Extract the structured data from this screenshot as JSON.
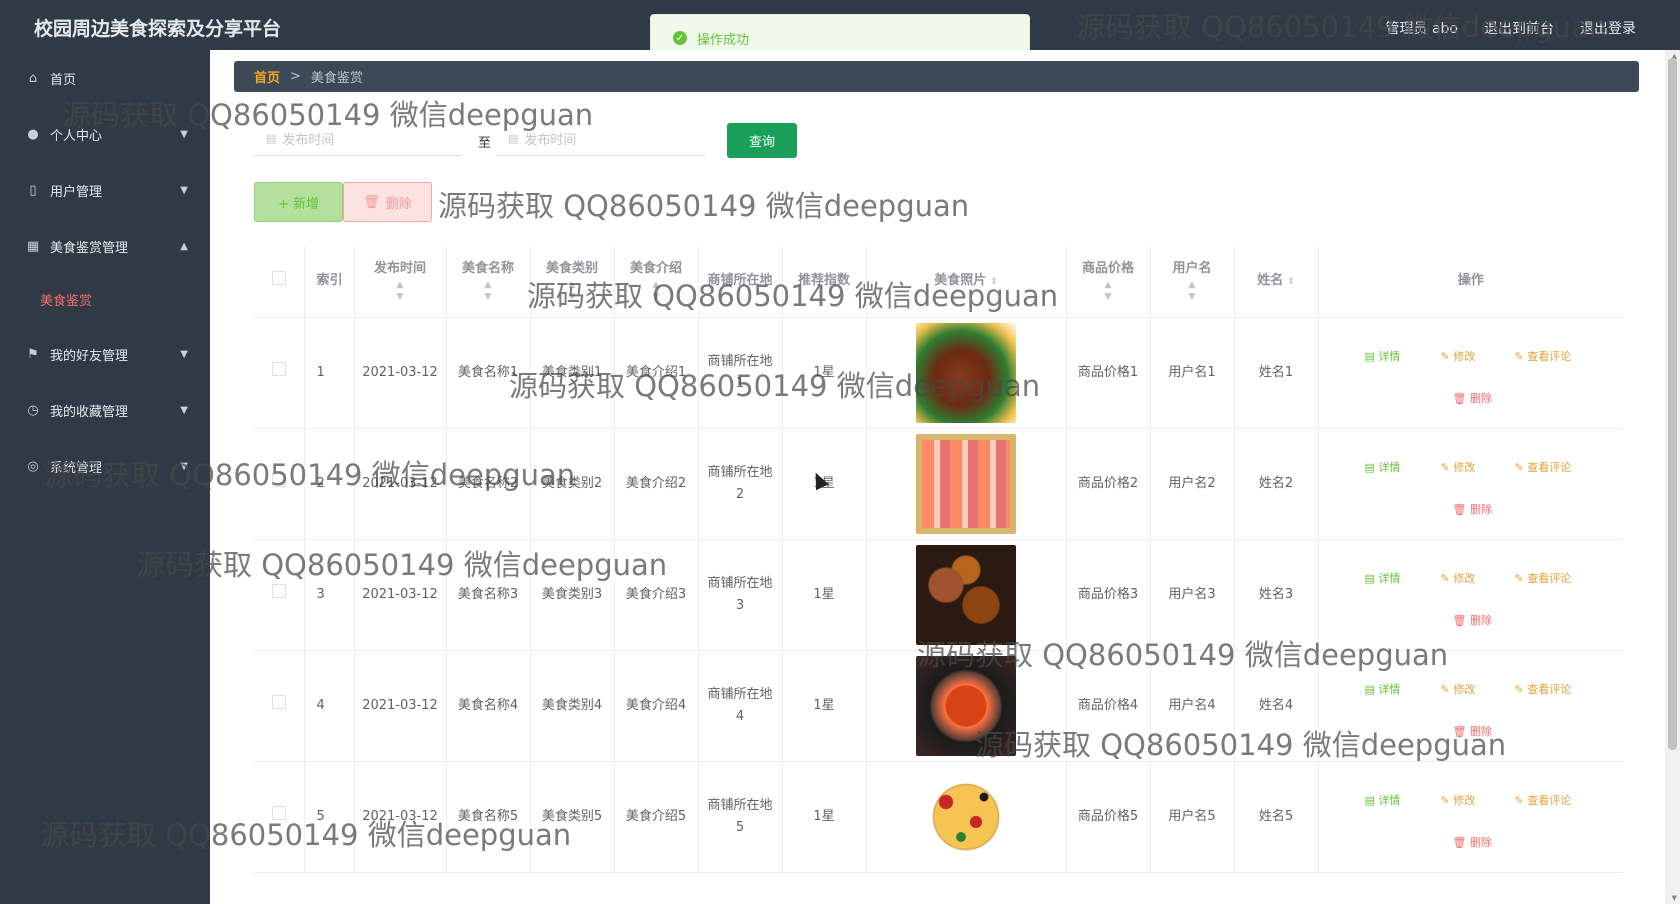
{
  "header": {
    "title": "校园周边美食探索及分享平台",
    "admin_label": "管理员 abo",
    "exit_backend": "退出到前台",
    "logout": "退出登录"
  },
  "toast": {
    "message": "操作成功"
  },
  "sidebar": {
    "items": [
      {
        "label": "首页",
        "icon": "home-icon"
      },
      {
        "label": "个人中心",
        "icon": "user-icon"
      },
      {
        "label": "用户管理",
        "icon": "mobile-icon"
      },
      {
        "label": "美食鉴赏管理",
        "icon": "grid-icon"
      },
      {
        "label": "美食鉴赏",
        "icon": ""
      },
      {
        "label": "我的好友管理",
        "icon": "flag-icon"
      },
      {
        "label": "我的收藏管理",
        "icon": "clock-icon"
      },
      {
        "label": "系统管理",
        "icon": "compass-icon"
      }
    ]
  },
  "breadcrumb": {
    "home": "首页",
    "separator": ">",
    "current": "美食鉴赏"
  },
  "filters": {
    "date_start_placeholder": "发布时间",
    "date_separator": "至",
    "date_end_placeholder": "发布时间",
    "query_label": "查询"
  },
  "actions": {
    "add_label": "+ 新增",
    "delete_label": "删除"
  },
  "table": {
    "headers": {
      "index": "索引",
      "publish_time": "发布时间",
      "food_name": "美食名称",
      "food_category": "美食类别",
      "food_intro": "美食介绍",
      "shop_location": "商铺所在地",
      "recommend": "推荐指数",
      "food_photo": "美食照片",
      "price": "商品价格",
      "username": "用户名",
      "name": "姓名",
      "operations": "操作"
    },
    "ops": {
      "detail": "详情",
      "edit": "修改",
      "review": "查看评论",
      "delete": "删除"
    },
    "rows": [
      {
        "index": "1",
        "time": "2021-03-12",
        "name": "美食名称1",
        "category": "美食类别1",
        "intro": "美食介绍1",
        "location": "商铺所在地1",
        "recommend": "1星",
        "photo": "food-1",
        "price": "商品价格1",
        "username": "用户名1",
        "fullname": "姓名1"
      },
      {
        "index": "2",
        "time": "2021-03-12",
        "name": "美食名称2",
        "category": "美食类别2",
        "intro": "美食介绍2",
        "location": "商铺所在地2",
        "recommend": "1星",
        "photo": "food-2",
        "price": "商品价格2",
        "username": "用户名2",
        "fullname": "姓名2"
      },
      {
        "index": "3",
        "time": "2021-03-12",
        "name": "美食名称3",
        "category": "美食类别3",
        "intro": "美食介绍3",
        "location": "商铺所在地3",
        "recommend": "1星",
        "photo": "food-3",
        "price": "商品价格3",
        "username": "用户名3",
        "fullname": "姓名3"
      },
      {
        "index": "4",
        "time": "2021-03-12",
        "name": "美食名称4",
        "category": "美食类别4",
        "intro": "美食介绍4",
        "location": "商铺所在地4",
        "recommend": "1星",
        "photo": "food-4",
        "price": "商品价格4",
        "username": "用户名4",
        "fullname": "姓名4"
      },
      {
        "index": "5",
        "time": "2021-03-12",
        "name": "美食名称5",
        "category": "美食类别5",
        "intro": "美食介绍5",
        "location": "商铺所在地5",
        "recommend": "1星",
        "photo": "food-5",
        "price": "商品价格5",
        "username": "用户名5",
        "fullname": "姓名5"
      }
    ]
  },
  "watermark": {
    "text": "源码获取 QQ86050149 微信deepguan"
  }
}
